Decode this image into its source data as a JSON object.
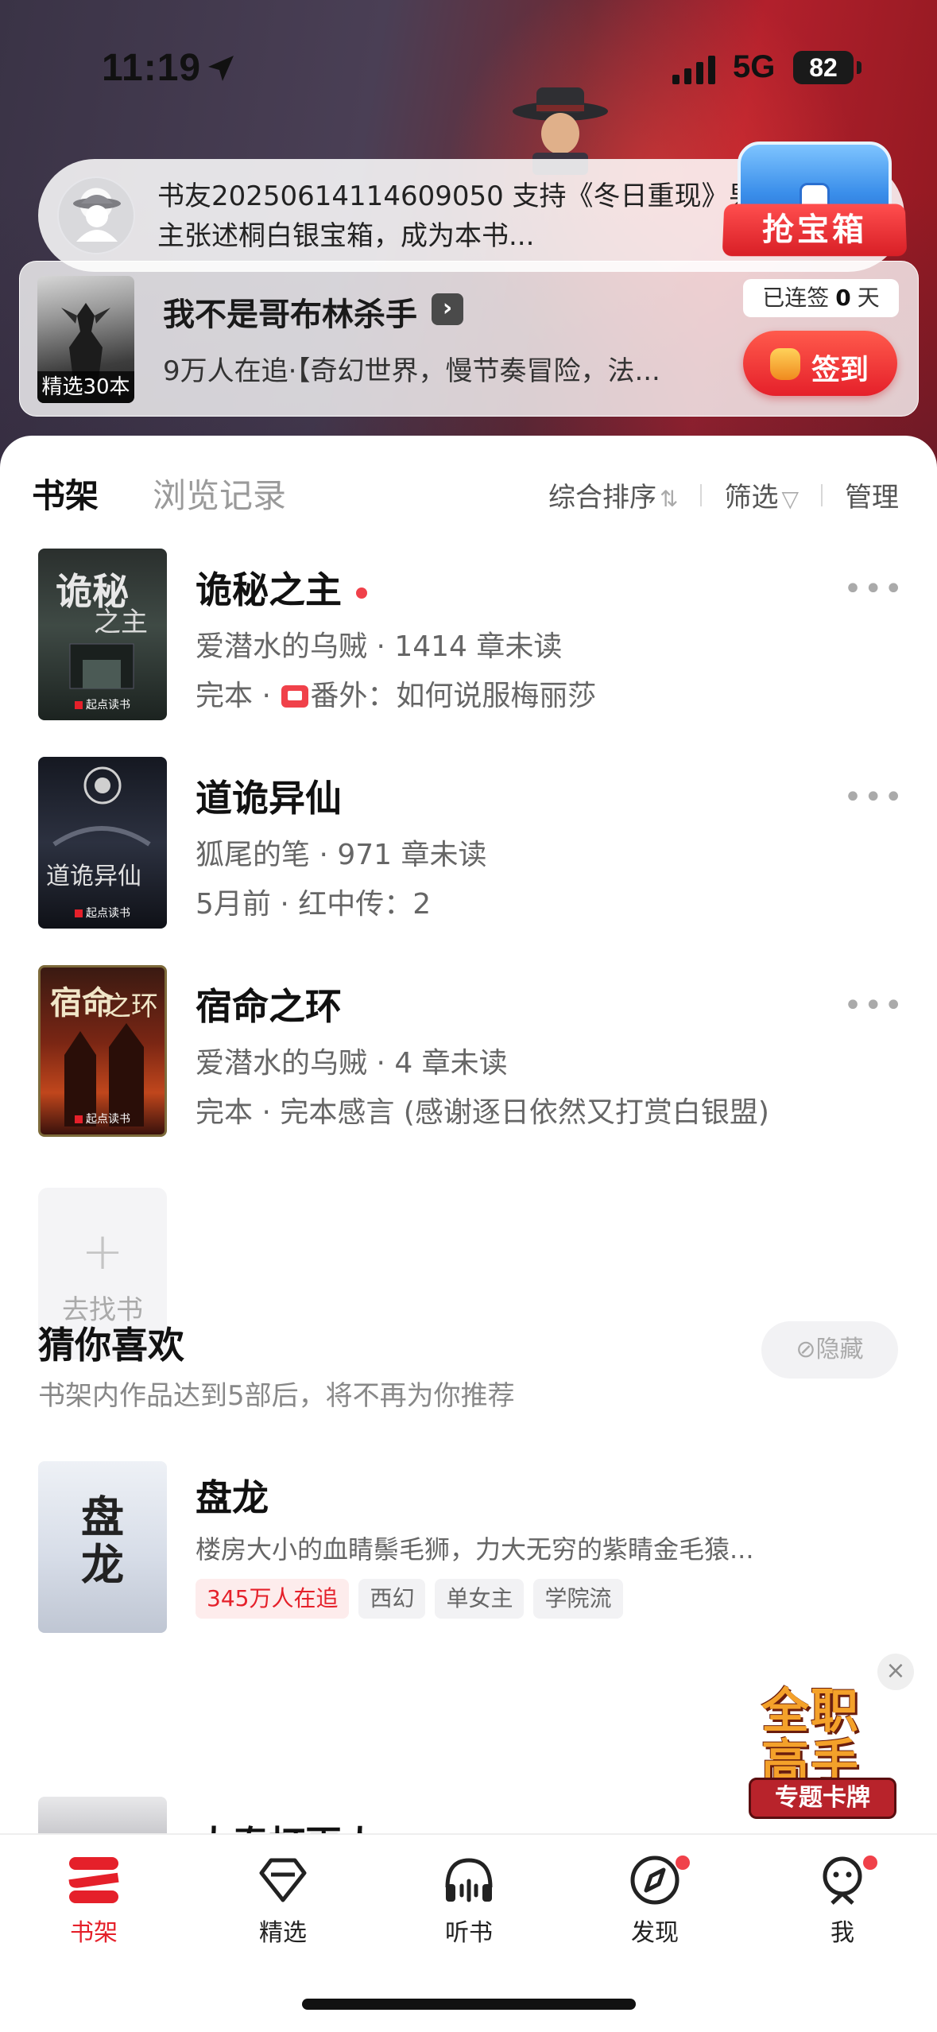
{
  "status_bar": {
    "time": "11:19",
    "network": "5G",
    "battery": "82"
  },
  "activity_banner": {
    "message": "书友20250614114609050 支持《冬日重现》男主张述桐白银宝箱，成为本书...",
    "chest_label": "抢宝箱"
  },
  "reading_card": {
    "cover_tag": "精选30本",
    "title": "我不是哥布林杀手",
    "description": "9万人在追·【奇幻世界，慢节奏冒险，法...",
    "streak_prefix": "已连签",
    "streak_days": "0",
    "streak_suffix": "天",
    "checkin_label": "签到"
  },
  "tabs": {
    "shelf": "书架",
    "history": "浏览记录"
  },
  "tools": {
    "sort": "综合排序",
    "filter": "筛选",
    "manage": "管理"
  },
  "books": [
    {
      "title": "诡秘之主",
      "line2": "爱潜水的乌贼 · 1414 章未读",
      "line3_pre": "完本 · ",
      "line3_post": "番外：如何说服梅丽莎",
      "unread_dot": true
    },
    {
      "title": "道诡异仙",
      "line2": "狐尾的笔 · 971 章未读",
      "line3": "5月前 · 红中传：2"
    },
    {
      "title": "宿命之环",
      "line2": "爱潜水的乌贼 · 4 章未读",
      "line3": "完本 · 完本感言 (感谢逐日依然又打赏白银盟)"
    }
  ],
  "add_book": {
    "icon": "+",
    "label": "去找书"
  },
  "recommend": {
    "title": "猜你喜欢",
    "subtitle": "书架内作品达到5部后，将不再为你推荐",
    "hide_label": "隐藏",
    "items": [
      {
        "title": "盘龙",
        "cover_text": "盘龙",
        "description": "楼房大小的血睛鬃毛狮，力大无穷的紫睛金毛猿...",
        "tags": [
          "345万人在追",
          "西幻",
          "单女主",
          "学院流"
        ]
      },
      {
        "title": "大奉打更人"
      }
    ]
  },
  "promo": {
    "line1": "全职",
    "line2": "高手",
    "line3": "专题卡牌"
  },
  "tabbar": [
    {
      "label": "书架",
      "icon": "bookshelf-icon",
      "active": true
    },
    {
      "label": "精选",
      "icon": "diamond-icon"
    },
    {
      "label": "听书",
      "icon": "headphones-icon"
    },
    {
      "label": "发现",
      "icon": "compass-icon",
      "badge": true
    },
    {
      "label": "我",
      "icon": "profile-icon",
      "badge": true
    }
  ],
  "colors": {
    "accent": "#e5202a",
    "badge": "#f0414a"
  }
}
